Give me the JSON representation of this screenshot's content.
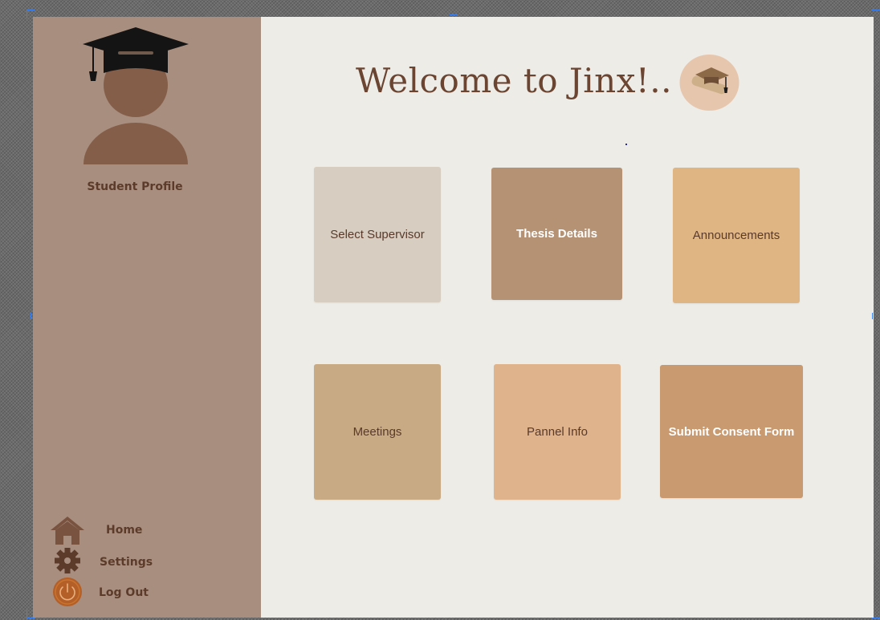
{
  "header": {
    "title": "Welcome to Jinx!.."
  },
  "sidebar": {
    "profile_label": "Student Profile",
    "nav": [
      {
        "label": "Home",
        "icon": "home-icon"
      },
      {
        "label": "Settings",
        "icon": "gear-icon"
      },
      {
        "label": "Log Out",
        "icon": "power-icon"
      }
    ]
  },
  "tiles": [
    {
      "label": "Select Supervisor",
      "color": "#d7cdc0"
    },
    {
      "label": "Thesis Details",
      "color": "#b69274"
    },
    {
      "label": "Announcements",
      "color": "#dfb583"
    },
    {
      "label": "Meetings",
      "color": "#c8ab84"
    },
    {
      "label": "Pannel Info",
      "color": "#dfb38b"
    },
    {
      "label": "Submit Consent Form",
      "color": "#c99970"
    }
  ],
  "colors": {
    "sidebar_bg": "#a88e7e",
    "main_bg": "#eeece6",
    "accent_brown": "#6b4532",
    "avatar_brown": "#845e49"
  }
}
